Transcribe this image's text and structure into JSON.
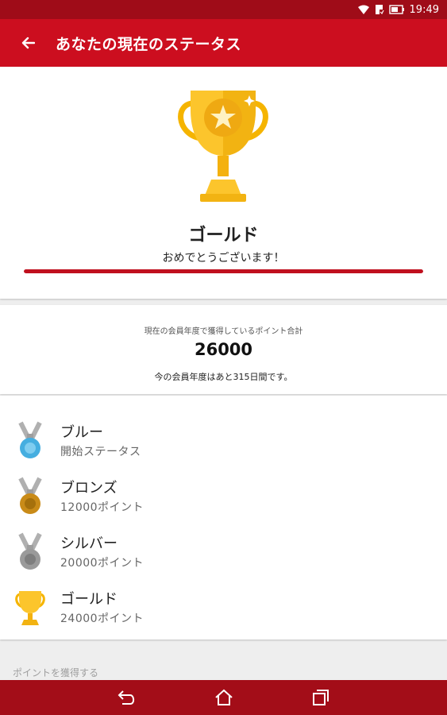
{
  "status_bar": {
    "time": "19:49"
  },
  "app_bar": {
    "title": "あなたの現在のステータス"
  },
  "current_status": {
    "level": "ゴールド",
    "message": "おめでとうございます！",
    "progress": 1.0
  },
  "points_summary": {
    "caption": "現在の会員年度で獲得しているポイント合計",
    "total": "26000",
    "remaining": "今の会員年度はあと315日間です。"
  },
  "levels": [
    {
      "name": "ブルー",
      "requirement": "開始ステータス",
      "icon": "blue-medal-icon",
      "color": "#45aee0"
    },
    {
      "name": "ブロンズ",
      "requirement": "12000ポイント",
      "icon": "bronze-medal-icon",
      "color": "#c98b18"
    },
    {
      "name": "シルバー",
      "requirement": "20000ポイント",
      "icon": "silver-medal-icon",
      "color": "#9a9a9a"
    },
    {
      "name": "ゴールド",
      "requirement": "24000ポイント",
      "icon": "gold-trophy-icon",
      "color": "#f7b900"
    }
  ],
  "earn_points": {
    "heading": "ポイントを獲得する"
  },
  "colors": {
    "primary": "#cc0e1f",
    "status_bar": "#9f0c18",
    "nav_bar": "#a30d18",
    "gold": "#f7b900"
  }
}
